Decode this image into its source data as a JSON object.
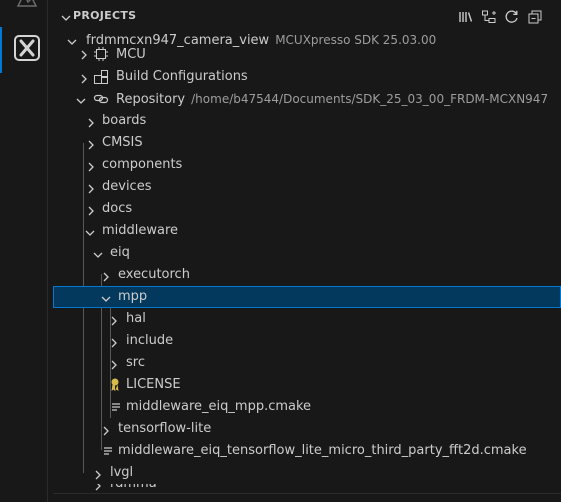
{
  "panel": {
    "title": "PROJECTS",
    "actions": [
      "library-icon",
      "tree-collapse-icon",
      "refresh-icon",
      "collapse-all-icon"
    ]
  },
  "project": {
    "name": "frdmmcxn947_camera_view",
    "sdk": "MCUXpresso SDK 25.03.00"
  },
  "items": {
    "mcu": "MCU",
    "build_configs": "Build Configurations",
    "repository": "Repository",
    "repository_path": "/home/b47544/Documents/SDK_25_03_00_FRDM-MCXN947",
    "boards": "boards",
    "cmsis": "CMSIS",
    "components": "components",
    "devices": "devices",
    "docs": "docs",
    "middleware": "middleware",
    "eiq": "eiq",
    "executorch": "executorch",
    "mpp": "mpp",
    "hal": "hal",
    "include": "include",
    "src": "src",
    "license": "LICENSE",
    "mpp_cmake": "middleware_eiq_mpp.cmake",
    "tensorflow_lite": "tensorflow-lite",
    "fft2d_cmake": "middleware_eiq_tensorflow_lite_micro_third_party_fft2d.cmake",
    "lvgl": "lvgl",
    "cut_off": "rdmma"
  },
  "colors": {
    "selection_bg": "#04395e",
    "selection_border": "#0078d4",
    "text": "#cccccc",
    "description": "#9d9d9d",
    "license_icon": "#d7ba4a"
  }
}
